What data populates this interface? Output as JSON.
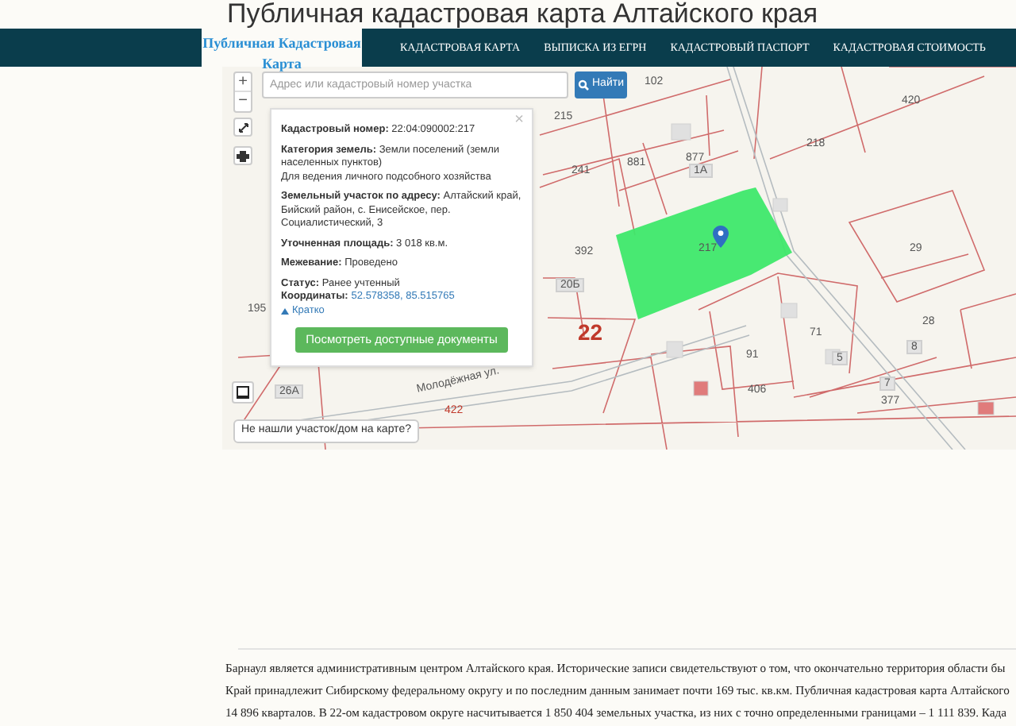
{
  "title": "Публичная кадастровая карта Алтайского края",
  "nav": {
    "brand": "Публичная Кадастровая Карта",
    "items": [
      {
        "label": "КАДАСТРОВАЯ КАРТА"
      },
      {
        "label": "ВЫПИСКА ИЗ ЕГРН"
      },
      {
        "label": "КАДАСТРОВЫЙ ПАСПОРТ"
      },
      {
        "label": "КАДАСТРОВАЯ СТОИМОСТЬ"
      }
    ]
  },
  "map": {
    "zoom_controls": [
      "+",
      "−"
    ],
    "search": {
      "placeholder": "Адрес или кадастровый номер участка",
      "button": "Найти"
    },
    "popup": {
      "close": "×",
      "lines": [
        {
          "kind": "gap",
          "text": "**Кадастровый номер:** 22:04:090002:217"
        },
        {
          "kind": "gap",
          "text": "**Категория земель:** Земли поселений (земли населенных пунктов)"
        },
        {
          "kind": "line",
          "text": "Для ведения личного подсобного хозяйства"
        },
        {
          "kind": "gap",
          "text": "**Земельный участок по адресу:** Алтайский край, Бийский район, с. Енисейское, пер. Социалистический, 3"
        },
        {
          "kind": "gap",
          "text": "**Уточненная площадь:** 3 018 кв.м."
        },
        {
          "kind": "gap",
          "text": "**Межевание:** Проведено"
        },
        {
          "kind": "gap",
          "text": "**Статус:** Ранее учтенный"
        }
      ],
      "coords_label": "Координаты:",
      "coords": "52.578358, 85.515765",
      "toggle": "Кратко",
      "button": "Посмотреть доступные документы"
    },
    "labels": [
      {
        "kind": "num",
        "text": "215"
      },
      {
        "kind": "num",
        "text": "102"
      },
      {
        "kind": "num",
        "text": "420"
      },
      {
        "kind": "num",
        "text": "218"
      },
      {
        "kind": "num",
        "text": "241"
      },
      {
        "kind": "num",
        "text": "881"
      },
      {
        "kind": "num",
        "text": "877"
      },
      {
        "kind": "house",
        "text": "1А"
      },
      {
        "kind": "num",
        "text": "392"
      },
      {
        "kind": "house",
        "text": "20Б"
      },
      {
        "kind": "num",
        "text": "217"
      },
      {
        "kind": "quarter",
        "text": "22"
      },
      {
        "kind": "num",
        "text": "29"
      },
      {
        "kind": "num",
        "text": "28"
      },
      {
        "kind": "num",
        "text": "71"
      },
      {
        "kind": "num",
        "text": "91"
      },
      {
        "kind": "num",
        "text": "406"
      },
      {
        "kind": "num",
        "text": "377"
      },
      {
        "kind": "num",
        "text": "195"
      },
      {
        "kind": "house",
        "text": "26А"
      },
      {
        "kind": "red",
        "text": "422"
      },
      {
        "kind": "house",
        "text": "5"
      },
      {
        "kind": "house",
        "text": "7"
      },
      {
        "kind": "house",
        "text": "8"
      },
      {
        "kind": "street",
        "text": "Молодёжная ул."
      }
    ],
    "hint": "Не нашли участок/дом на карте?"
  },
  "article": {
    "lines": [
      "Барнаул является административным центром Алтайского края. Исторические записи свидетельствуют о том, что окончательно территория области бы",
      "Край принадлежит Сибирскому федеральному округу и по последним данным занимает почти 169 тыс. кв.км. Публичная кадастровая карта Алтайского",
      "14 896 кварталов. В 22-ом кадастровом округе насчитывается 1 850 404 земельных участка, из них с точно определенными границами – 1 111 839. Када"
    ]
  }
}
